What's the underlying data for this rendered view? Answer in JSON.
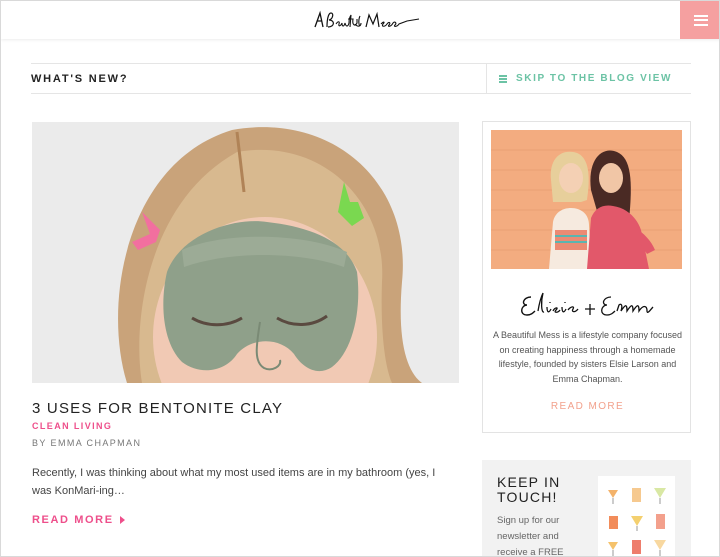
{
  "header": {
    "logo_text": "A Beautiful Mess",
    "menu_icon": "hamburger-icon",
    "menu_color": "#f5a0a0"
  },
  "news_bar": {
    "title": "WHAT'S NEW?",
    "skip_label": "SKIP TO THE BLOG VIEW",
    "skip_icon": "list-icon",
    "accent": "#6cc3a5"
  },
  "article": {
    "image_alt": "Woman wearing a green clay face mask with hair clips",
    "title": "3 USES FOR BENTONITE CLAY",
    "category": "CLEAN LIVING",
    "author": "BY EMMA CHAPMAN",
    "excerpt": "Recently, I was thinking about what my most used items are in my bathroom (yes, I was KonMari-ing…",
    "read_more": "READ MORE",
    "accent": "#ee4f8b"
  },
  "about": {
    "photo_alt": "Elsie and Emma in front of an orange wall",
    "signature": "Elsie + Emma",
    "description": "A Beautiful Mess is a lifestyle company focused on creating happiness through a homemade lifestyle, founded by sisters Elsie Larson and Emma Chapman.",
    "read_more": "READ MORE",
    "accent": "#f2a18c"
  },
  "newsletter": {
    "heading": "KEEP IN TOUCH!",
    "body": "Sign up for our newsletter and receive a FREE",
    "thumb_alt": "Cocktail recipe print"
  }
}
